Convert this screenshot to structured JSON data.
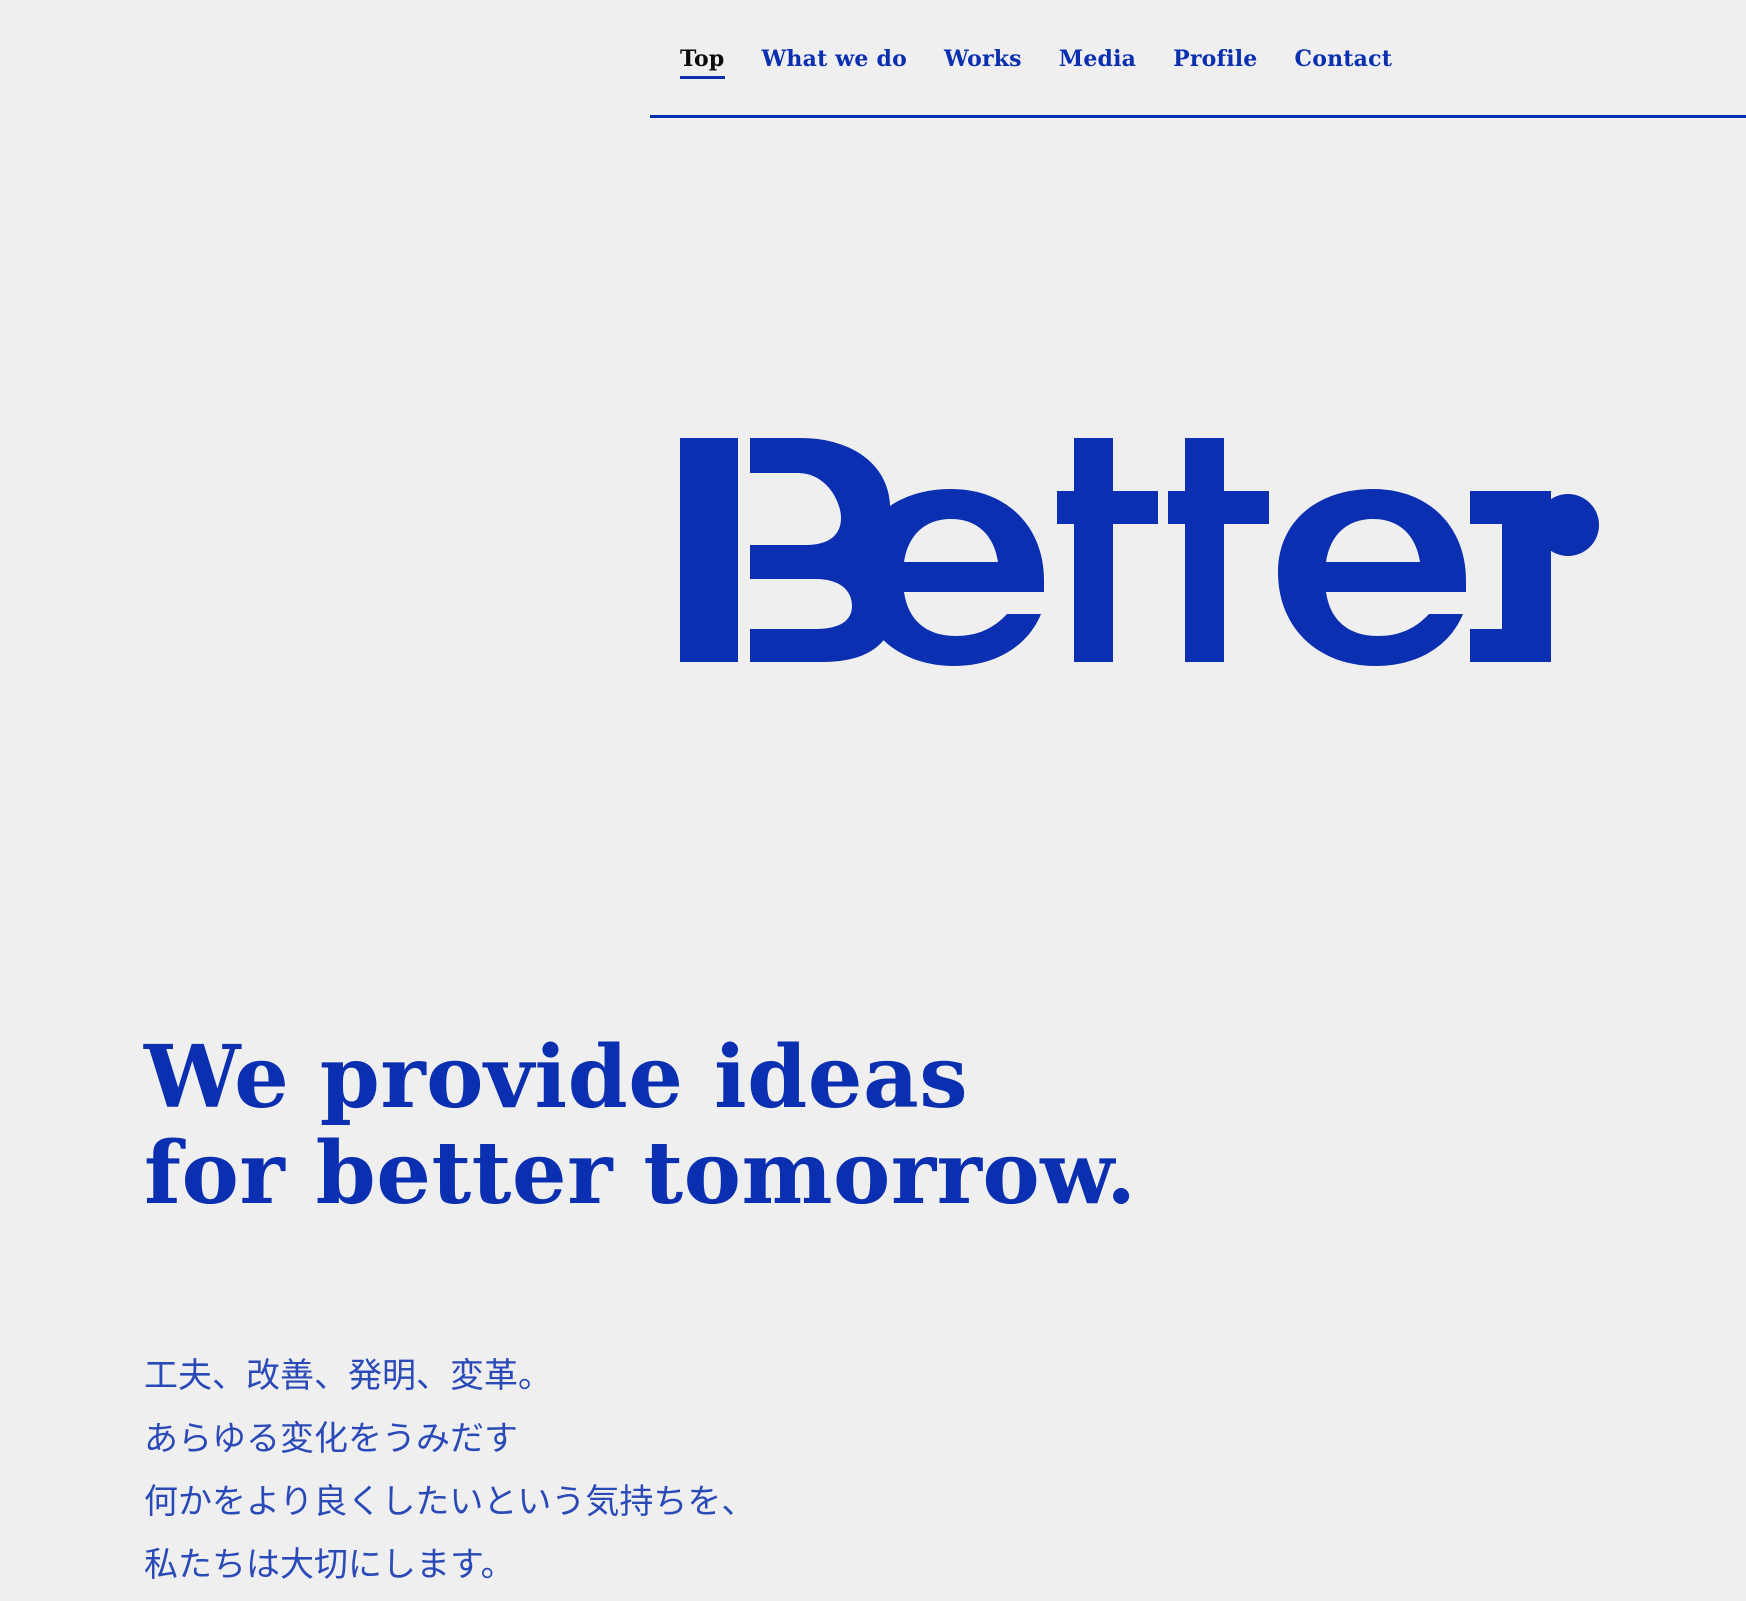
{
  "nav": {
    "items": [
      {
        "label": "Top",
        "active": true
      },
      {
        "label": "What we do",
        "active": false
      },
      {
        "label": "Works",
        "active": false
      },
      {
        "label": "Media",
        "active": false
      },
      {
        "label": "Profile",
        "active": false
      },
      {
        "label": "Contact",
        "active": false
      }
    ]
  },
  "logo": {
    "text": "Better"
  },
  "hero": {
    "line1": "We provide ideas",
    "line2": "for better tomorrow."
  },
  "message": {
    "lines": [
      "工夫、改善、発明、変革。",
      "あらゆる変化をうみだす",
      "何かをより良くしたいという気持ちを、",
      "私たちは大切にします。"
    ]
  },
  "colors": {
    "accent": "#0a2fb0",
    "background": "#efefef",
    "active_nav_text": "#0b0b0b"
  }
}
